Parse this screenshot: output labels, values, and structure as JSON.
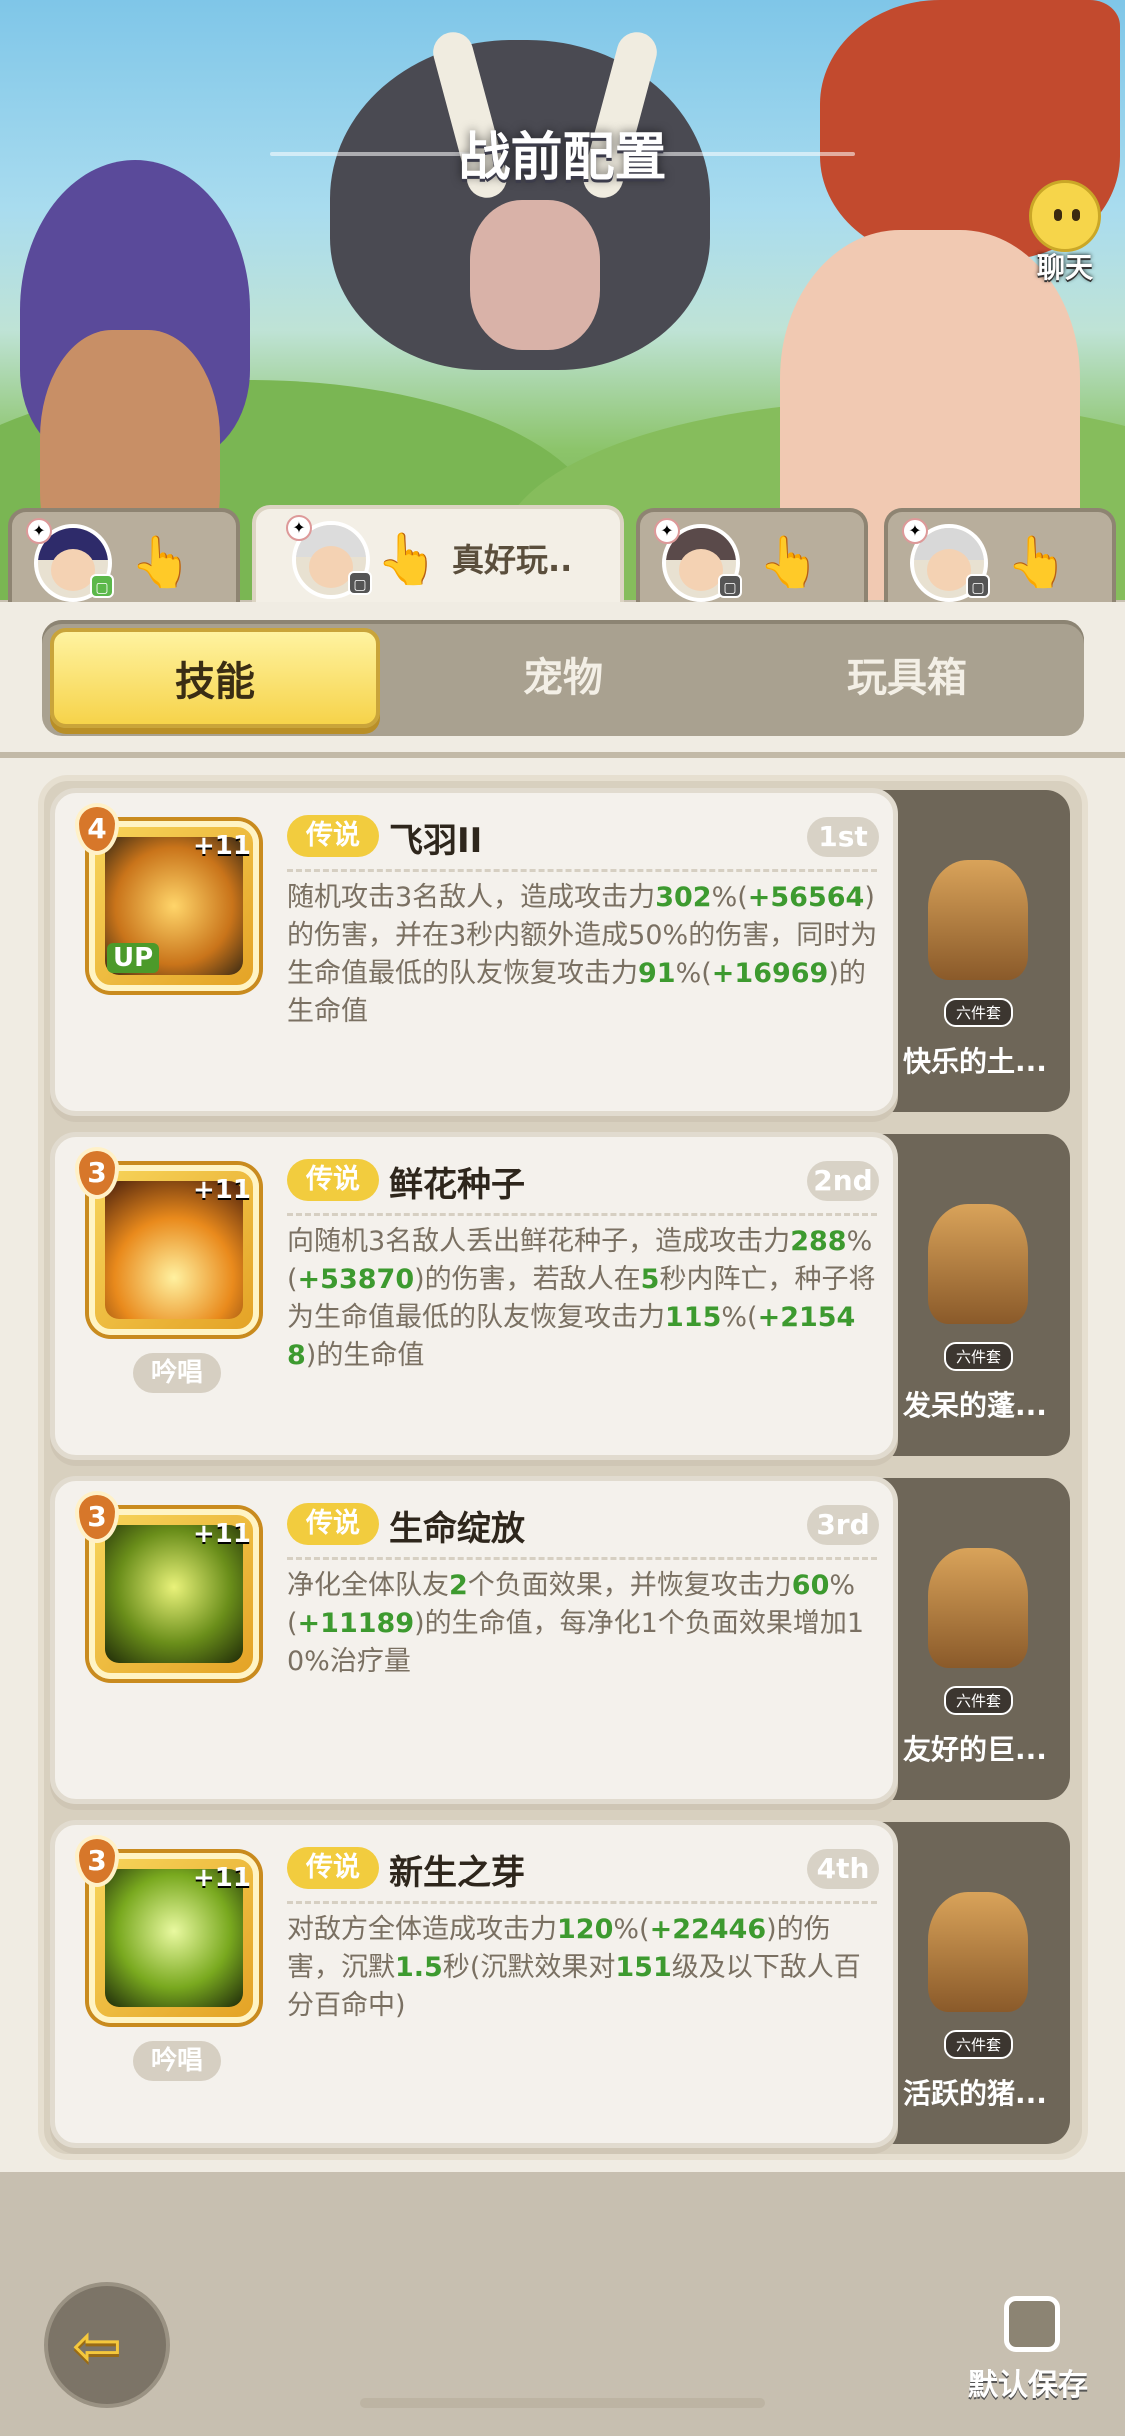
{
  "header": {
    "title": "战前配置",
    "chat_label": "聊天"
  },
  "team_tabs": [
    {
      "name": "",
      "active": false
    },
    {
      "name": "真好玩..",
      "active": true
    },
    {
      "name": "",
      "active": false
    },
    {
      "name": "",
      "active": false
    }
  ],
  "segments": [
    "技能",
    "宠物",
    "玩具箱"
  ],
  "active_segment": "技能",
  "skills": [
    {
      "level": "4",
      "plus": "+11",
      "up": "UP",
      "cast": "",
      "rarity": "传说",
      "name": "飞羽II",
      "rank": "1st",
      "desc": [
        "随机攻击3名敌人，造成攻击力",
        {
          "g": "302"
        },
        "%(",
        {
          "g": "+56564"
        },
        ")的伤害，并在3秒内额外造成50%的伤害，同时为生命值最低的队友恢复攻击力",
        {
          "g": "91"
        },
        "%(",
        {
          "g": "+16969"
        },
        ")的生命值"
      ],
      "pet": {
        "set": "六件套",
        "name": "快乐的土..."
      }
    },
    {
      "level": "3",
      "plus": "+11",
      "up": "",
      "cast": "吟唱",
      "rarity": "传说",
      "name": "鲜花种子",
      "rank": "2nd",
      "desc": [
        "向随机3名敌人丢出鲜花种子，造成攻击力",
        {
          "g": "288"
        },
        "%(",
        {
          "g": "+53870"
        },
        ")的伤害，若敌人在",
        {
          "g": "5"
        },
        "秒内阵亡，种子将为生命值最低的队友恢复攻击力",
        {
          "g": "115"
        },
        "%(",
        {
          "g": "+21548"
        },
        ")的生命值"
      ],
      "pet": {
        "set": "六件套",
        "name": "发呆的蓬..."
      }
    },
    {
      "level": "3",
      "plus": "+11",
      "up": "",
      "cast": "",
      "rarity": "传说",
      "name": "生命绽放",
      "rank": "3rd",
      "desc": [
        "净化全体队友",
        {
          "g": "2"
        },
        "个负面效果，并恢复攻击力",
        {
          "g": "60"
        },
        "%(",
        {
          "g": "+11189"
        },
        ")的生命值，每净化1个负面效果增加10%治疗量"
      ],
      "pet": {
        "set": "六件套",
        "name": "友好的巨..."
      }
    },
    {
      "level": "3",
      "plus": "+11",
      "up": "",
      "cast": "吟唱",
      "rarity": "传说",
      "name": "新生之芽",
      "rank": "4th",
      "desc": [
        "对敌方全体造成攻击力",
        {
          "g": "120"
        },
        "%(",
        {
          "g": "+22446"
        },
        ")的伤害，沉默",
        {
          "g": "1.5"
        },
        "秒(沉默效果对",
        {
          "g": "151"
        },
        "级及以下敌人百分百命中)"
      ],
      "pet": {
        "set": "六件套",
        "name": "活跃的猪..."
      }
    }
  ],
  "footer": {
    "save_label": "默认保存"
  },
  "colors": {
    "accent": "#f6d34a",
    "highlight_number": "#3d9a2f",
    "rarity": "#f2cc3e"
  }
}
